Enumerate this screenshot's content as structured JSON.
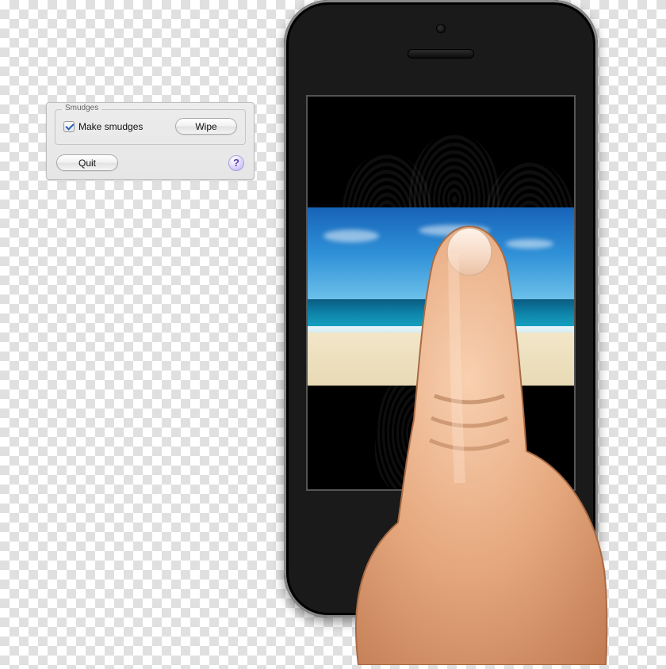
{
  "dialog": {
    "fieldset_title": "Smudges",
    "make_smudges_label": "Make smudges",
    "make_smudges_checked": true,
    "wipe_label": "Wipe",
    "quit_label": "Quit",
    "help_label": "?"
  }
}
